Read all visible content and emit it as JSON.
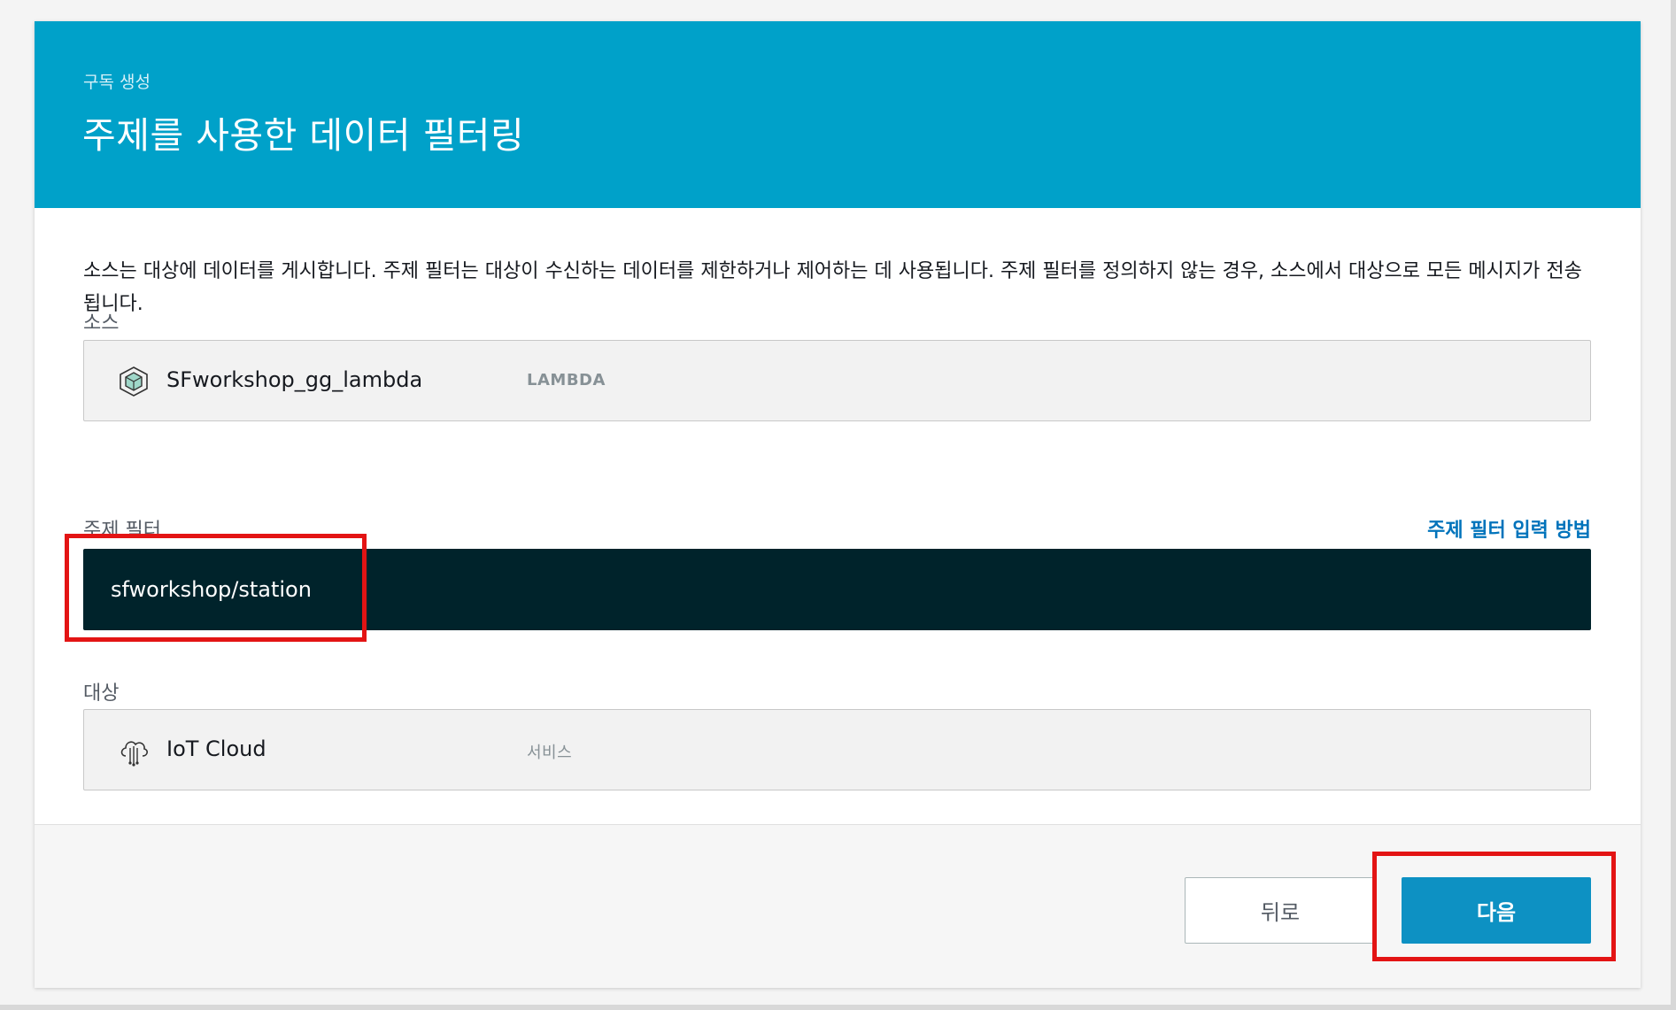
{
  "header": {
    "breadcrumb": "구독 생성",
    "title": "주제를 사용한 데이터 필터링",
    "background_color": "#00a1c9"
  },
  "description": "소스는 대상에 데이터를 게시합니다. 주제 필터는 대상이 수신하는 데이터를 제한하거나 제어하는 데 사용됩니다. 주제 필터를 정의하지 않는 경우, 소스에서 대상으로 모든 메시지가 전송됩니다.",
  "source": {
    "label": "소스",
    "name": "SFworkshop_gg_lambda",
    "type": "LAMBDA",
    "icon": "lambda-cube-icon"
  },
  "topic_filter": {
    "label": "주제 필터",
    "help_link": "주제 필터 입력 방법",
    "value": "sfworkshop/station",
    "placeholder": ""
  },
  "target": {
    "label": "대상",
    "name": "IoT Cloud",
    "type": "서비스",
    "icon": "iot-cloud-icon"
  },
  "footer": {
    "back_label": "뒤로",
    "next_label": "다음",
    "primary_color": "#0d91c3"
  },
  "highlight_color": "#e31414"
}
